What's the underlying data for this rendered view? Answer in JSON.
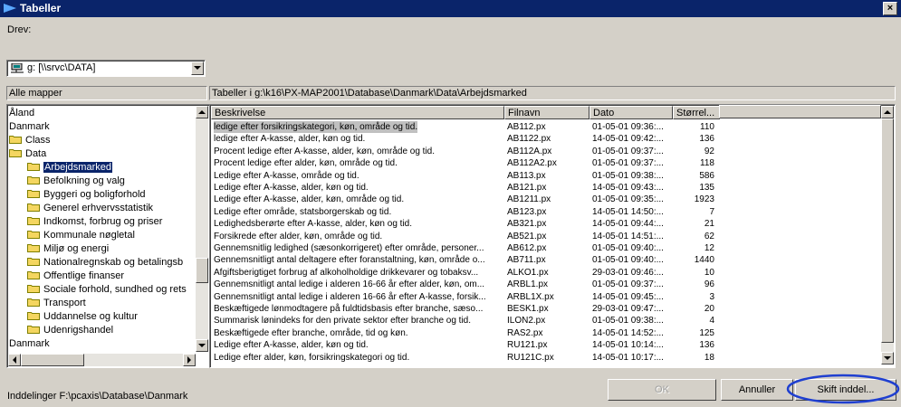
{
  "window": {
    "title": "Tabeller",
    "close_glyph": "×"
  },
  "drive": {
    "label": "Drev:",
    "value": "g: [\\\\srvc\\DATA]"
  },
  "left_panel": {
    "header": "Alle mapper",
    "items": [
      {
        "label": "Åland",
        "indent": 0,
        "folder": false
      },
      {
        "label": "Danmark",
        "indent": 0,
        "folder": false
      },
      {
        "label": "Class",
        "indent": 0,
        "folder": true
      },
      {
        "label": "Data",
        "indent": 0,
        "folder": true
      },
      {
        "label": "Arbejdsmarked",
        "indent": 1,
        "folder": true,
        "selected": true
      },
      {
        "label": "Befolkning og valg",
        "indent": 1,
        "folder": true
      },
      {
        "label": "Byggeri og boligforhold",
        "indent": 1,
        "folder": true
      },
      {
        "label": "Generel erhvervsstatistik",
        "indent": 1,
        "folder": true
      },
      {
        "label": "Indkomst, forbrug og priser",
        "indent": 1,
        "folder": true
      },
      {
        "label": "Kommunale nøgletal",
        "indent": 1,
        "folder": true
      },
      {
        "label": "Miljø og energi",
        "indent": 1,
        "folder": true
      },
      {
        "label": "Nationalregnskab og betalingsb",
        "indent": 1,
        "folder": true
      },
      {
        "label": "Offentlige finanser",
        "indent": 1,
        "folder": true
      },
      {
        "label": "Sociale forhold, sundhed og rets",
        "indent": 1,
        "folder": true
      },
      {
        "label": "Transport",
        "indent": 1,
        "folder": true
      },
      {
        "label": "Uddannelse og kultur",
        "indent": 1,
        "folder": true
      },
      {
        "label": "Udenrigshandel",
        "indent": 1,
        "folder": true
      },
      {
        "label": "Danmark",
        "indent": 0,
        "folder": false
      }
    ]
  },
  "right_panel": {
    "header": "Tabeller i g:\\k16\\PX-MAP2001\\Database\\Danmark\\Data\\Arbejdsmarked",
    "columns": [
      "Beskrivelse",
      "Filnavn",
      "Dato",
      "Størrel..."
    ],
    "rows": [
      [
        "ledige efter forsikringskategori, køn, område og tid.",
        "AB112.px",
        "01-05-01 09:36:...",
        "110"
      ],
      [
        "ledige efter A-kasse, alder, køn og tid.",
        "AB1122.px",
        "14-05-01 09:42:...",
        "136"
      ],
      [
        "Procent ledige efter A-kasse, alder, køn, område og tid.",
        "AB112A.px",
        "01-05-01 09:37:...",
        "92"
      ],
      [
        "Procent ledige efter alder, køn, område og tid.",
        "AB112A2.px",
        "01-05-01 09:37:...",
        "118"
      ],
      [
        "Ledige efter A-kasse, område og tid.",
        "AB113.px",
        "01-05-01 09:38:...",
        "586"
      ],
      [
        "Ledige efter A-kasse, alder, køn og tid.",
        "AB121.px",
        "14-05-01 09:43:...",
        "135"
      ],
      [
        "Ledige efter A-kasse, alder, køn, område og tid.",
        "AB1211.px",
        "01-05-01 09:35:...",
        "1923"
      ],
      [
        "Ledige efter område, statsborgerskab og tid.",
        "AB123.px",
        "14-05-01 14:50:...",
        "7"
      ],
      [
        "Ledighedsberørte efter A-kasse, alder, køn og tid.",
        "AB321.px",
        "14-05-01 09:44:...",
        "21"
      ],
      [
        "Forsikrede efter alder, køn, område og tid.",
        "AB521.px",
        "14-05-01 14:51:...",
        "62"
      ],
      [
        "Gennemsnitlig ledighed (sæsonkorrigeret) efter område, personer...",
        "AB612.px",
        "01-05-01 09:40:...",
        "12"
      ],
      [
        "Gennemsnitligt antal deltagere efter foranstaltning, køn, område o...",
        "AB711.px",
        "01-05-01 09:40:...",
        "1440"
      ],
      [
        "Afgiftsberigtiget forbrug af alkoholholdige drikkevarer og tobaksv...",
        "ALKO1.px",
        "29-03-01 09:46:...",
        "10"
      ],
      [
        "Gennemsnitligt antal ledige i alderen 16-66 år efter alder, køn, om...",
        "ARBL1.px",
        "01-05-01 09:37:...",
        "96"
      ],
      [
        "Gennemsnitligt antal ledige i alderen 16-66 år efter A-kasse, forsik...",
        "ARBL1X.px",
        "14-05-01 09:45:...",
        "3"
      ],
      [
        "Beskæftigede lønmodtagere på fuldtidsbasis efter branche, sæso...",
        "BESK1.px",
        "29-03-01 09:47:...",
        "20"
      ],
      [
        "Summarisk lønindeks for den private sektor efter branche og tid.",
        "ILON2.px",
        "01-05-01 09:38:...",
        "4"
      ],
      [
        "Beskæftigede efter branche, område, tid og køn.",
        "RAS2.px",
        "14-05-01 14:52:...",
        "125"
      ],
      [
        "Ledige efter A-kasse, alder, køn og tid.",
        "RU121.px",
        "14-05-01 10:14:...",
        "136"
      ],
      [
        "Ledige efter alder, køn, forsikringskategori og tid.",
        "RU121C.px",
        "14-05-01 10:17:...",
        "18"
      ]
    ]
  },
  "footer": {
    "status": "Inddelinger F:\\pcaxis\\Database\\Danmark",
    "ok_label": "OK",
    "cancel_label": "Annuller",
    "change_label": "Skift inddel..."
  },
  "colors": {
    "title_bg": "#0a246a",
    "highlight": "#0a246a",
    "annotation_circle": "#1f3fd0"
  }
}
